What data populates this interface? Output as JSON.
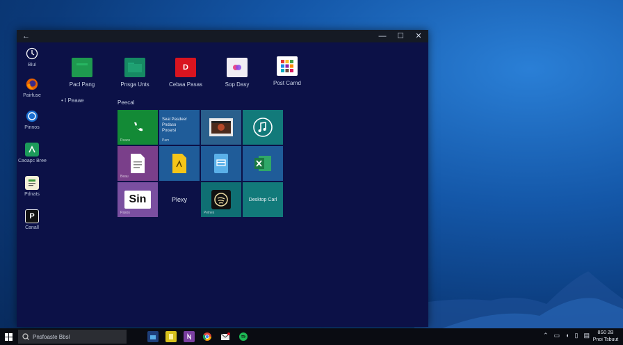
{
  "window": {
    "back_glyph": "←",
    "minimize_glyph": "—",
    "maximize_glyph": "☐",
    "close_glyph": "✕"
  },
  "rail": {
    "items": [
      {
        "label": "Biui",
        "icon": "clock-icon"
      },
      {
        "label": "Pairfuse",
        "icon": "firefox-icon"
      },
      {
        "label": "Pinnos",
        "icon": "skype-icon"
      },
      {
        "label": "Caoapc Bree",
        "icon": "maps-icon"
      },
      {
        "label": "Pdnats",
        "icon": "notes-icon"
      },
      {
        "label": "Canall",
        "icon": "p-app-icon"
      }
    ]
  },
  "apps": [
    {
      "label": "Pacl Pang",
      "color": "#1e9a4f"
    },
    {
      "label": "Pnsga Unts",
      "color": "#168a63"
    },
    {
      "label": "Cebaa Pasas",
      "color": "#d9141f"
    },
    {
      "label": "Sop Dasy",
      "color": "#f1eef4"
    },
    {
      "label": "Post Carnd",
      "color": "#ffffff"
    }
  ],
  "side_note": "•  I  Peaae",
  "group_title": "Peecal",
  "tiles": {
    "phone": {
      "caption": "Peaos",
      "color": "#138a36"
    },
    "info": {
      "title": "Seal Pasdeer",
      "line1": "Pndaso",
      "line2": "Pooarsi",
      "caption": "Pam",
      "color": "#1f5c99"
    },
    "movies": {
      "caption": "",
      "color": "#2a5f8c"
    },
    "groove": {
      "caption": "",
      "color": "#127a7a"
    },
    "docs": {
      "caption": "Beau",
      "color": "#7a3f8a"
    },
    "files": {
      "caption": "",
      "color": "#1f5c99"
    },
    "tablet": {
      "caption": "",
      "color": "#1f5c99"
    },
    "excel": {
      "caption": "",
      "color": "#1f5c99"
    },
    "sin": {
      "text": "Sin",
      "caption": "Pasos",
      "color": "#7a4fa0"
    },
    "plain": {
      "text": "Plexy"
    },
    "music": {
      "caption": "Pelnes",
      "color": "#0f6f73"
    },
    "desktop": {
      "text": "Desktop Carl",
      "color": "#127a7a"
    }
  },
  "taskbar": {
    "search_text": "Pnsfoaste Bbsl",
    "clock_time": "8S0 2B",
    "clock_date": "Pnoi Tsbuut",
    "icons": [
      {
        "name": "store-icon",
        "color": "#1e3f7a"
      },
      {
        "name": "notes-icon",
        "color": "#d8c21c"
      },
      {
        "name": "onenote-icon",
        "color": "#7a3fa0"
      },
      {
        "name": "chrome-icon",
        "color": "#2a2a2a"
      },
      {
        "name": "mail-icon",
        "color": "#1a1a1a"
      },
      {
        "name": "spotify-icon",
        "color": "#1a1a1a"
      }
    ]
  }
}
